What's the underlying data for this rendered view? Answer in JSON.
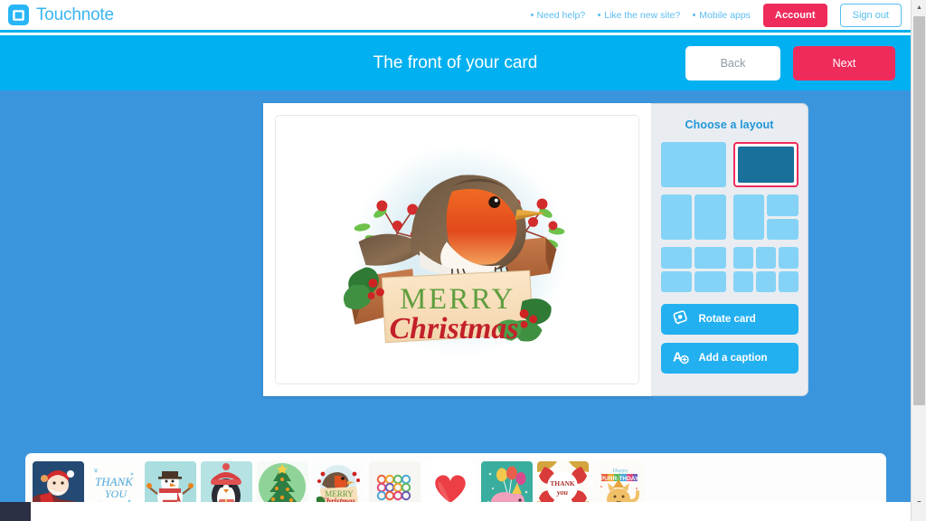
{
  "brand": {
    "name": "Touchnote",
    "icon": "stamp-icon",
    "color": "#3ab5f0"
  },
  "topnav": {
    "links": [
      {
        "label": "Need help?"
      },
      {
        "label": "Like the new site?"
      },
      {
        "label": "Mobile apps"
      }
    ],
    "account_label": "Account",
    "signout_label": "Sign out",
    "account_color": "#ef2b5b"
  },
  "stepbar": {
    "title": "The front of your card",
    "back_label": "Back",
    "next_label": "Next",
    "bg_color": "#00b0f0",
    "next_color": "#ef2b5b"
  },
  "sidebar": {
    "title": "Choose a layout",
    "selected_index": 1,
    "selected_color": "#ef2b5b",
    "layouts": [
      {
        "name": "layout-single-full",
        "cells": 1,
        "pattern": "full"
      },
      {
        "name": "layout-single-full-selected",
        "cells": 1,
        "pattern": "full"
      },
      {
        "name": "layout-two-vertical",
        "cells": 2,
        "pattern": "two-columns"
      },
      {
        "name": "layout-one-plus-two",
        "cells": 3,
        "pattern": "left-tall-two-right"
      },
      {
        "name": "layout-four-grid",
        "cells": 4,
        "pattern": "2x2"
      },
      {
        "name": "layout-six-grid",
        "cells": 6,
        "pattern": "3x2"
      }
    ],
    "buttons": [
      {
        "label": "Rotate card",
        "icon": "rotate-photo-icon"
      },
      {
        "label": "Add a caption",
        "icon": "add-text-icon"
      }
    ]
  },
  "card": {
    "name": "merry-christmas-robin-card",
    "headline": "MERRY",
    "subline": "Christmas",
    "headline_color": "#5f9e3e",
    "subline_color": "#c3202a"
  },
  "tray": {
    "thumbnails": [
      {
        "name": "thumb-santa",
        "caption": ""
      },
      {
        "name": "thumb-thank-you-script",
        "caption": "THANK YOU"
      },
      {
        "name": "thumb-snowman",
        "caption": ""
      },
      {
        "name": "thumb-penguin",
        "caption": ""
      },
      {
        "name": "thumb-christmas-tree",
        "caption": ""
      },
      {
        "name": "thumb-merry-christmas-robin",
        "caption": "MERRY Christmas"
      },
      {
        "name": "thumb-alphabet-circles",
        "caption": ""
      },
      {
        "name": "thumb-heart",
        "caption": ""
      },
      {
        "name": "thumb-elephant-balloons",
        "caption": ""
      },
      {
        "name": "thumb-thank-you-petals",
        "caption": "THANK you"
      },
      {
        "name": "thumb-purr-thday-cat",
        "caption": "Happy PURR-THDAY"
      }
    ]
  },
  "scrollbar": {
    "up_glyph": "▲",
    "down_glyph": "▼"
  }
}
